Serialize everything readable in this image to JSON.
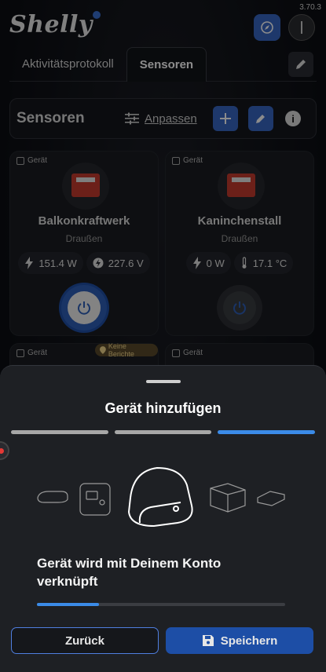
{
  "status": {
    "version": "3.70.3"
  },
  "header": {
    "logo_text": "Shelly"
  },
  "tabs": [
    {
      "label": "Aktivitätsprotokoll"
    },
    {
      "label": "Sensoren"
    }
  ],
  "sensor_bar": {
    "title": "Sensoren",
    "adjust_label": "Anpassen",
    "info_label": "i"
  },
  "cards": [
    {
      "tag": "Gerät",
      "name": "Balkonkraftwerk",
      "room": "Draußen",
      "metric1": "151.4 W",
      "metric2": "227.6 V",
      "state": "on"
    },
    {
      "tag": "Gerät",
      "name": "Kaninchenstall",
      "room": "Draußen",
      "metric1": "0 W",
      "metric2": "17.1 °C",
      "state": "off"
    },
    {
      "tag": "Gerät",
      "badge": "Keine Berichte"
    },
    {
      "tag": "Gerät"
    }
  ],
  "sheet": {
    "title": "Gerät hinzufügen",
    "steps": [
      {
        "state": "done"
      },
      {
        "state": "done"
      },
      {
        "state": "active"
      }
    ],
    "message": "Gerät wird mit Deinem Konto verknüpft",
    "progress": 0.25,
    "back_label": "Zurück",
    "save_label": "Speichern"
  },
  "colors": {
    "accent": "#3767c4",
    "progress": "#3b8be8"
  }
}
